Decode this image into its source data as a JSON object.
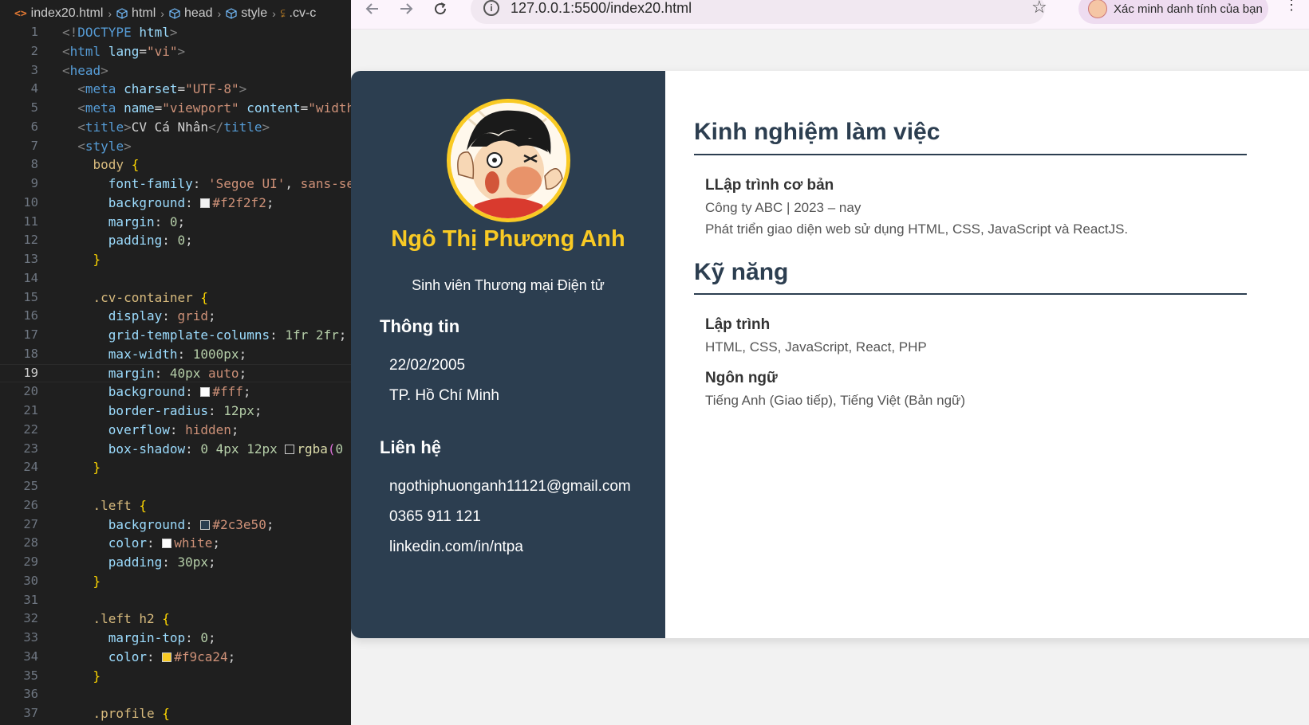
{
  "editor": {
    "breadcrumb": [
      "index20.html",
      "html",
      "head",
      "style",
      ".cv-c"
    ],
    "current_line": 19,
    "lines": [
      [
        [
          "t-punct",
          "<!"
        ],
        [
          "t-tag",
          "DOCTYPE"
        ],
        [
          "t-text",
          " "
        ],
        [
          "t-attr",
          "html"
        ],
        [
          "t-punct",
          ">"
        ]
      ],
      [
        [
          "t-punct",
          "<"
        ],
        [
          "t-tag",
          "html"
        ],
        [
          "t-text",
          " "
        ],
        [
          "t-attr",
          "lang"
        ],
        [
          "t-text",
          "="
        ],
        [
          "t-str",
          "\"vi\""
        ],
        [
          "t-punct",
          ">"
        ]
      ],
      [
        [
          "t-punct",
          "<"
        ],
        [
          "t-tag",
          "head"
        ],
        [
          "t-punct",
          ">"
        ]
      ],
      [
        [
          "t-text",
          "  "
        ],
        [
          "t-punct",
          "<"
        ],
        [
          "t-tag",
          "meta"
        ],
        [
          "t-text",
          " "
        ],
        [
          "t-attr",
          "charset"
        ],
        [
          "t-text",
          "="
        ],
        [
          "t-str",
          "\"UTF-8\""
        ],
        [
          "t-punct",
          ">"
        ]
      ],
      [
        [
          "t-text",
          "  "
        ],
        [
          "t-punct",
          "<"
        ],
        [
          "t-tag",
          "meta"
        ],
        [
          "t-text",
          " "
        ],
        [
          "t-attr",
          "name"
        ],
        [
          "t-text",
          "="
        ],
        [
          "t-str",
          "\"viewport\""
        ],
        [
          "t-text",
          " "
        ],
        [
          "t-attr",
          "content"
        ],
        [
          "t-text",
          "="
        ],
        [
          "t-str",
          "\"width"
        ]
      ],
      [
        [
          "t-text",
          "  "
        ],
        [
          "t-punct",
          "<"
        ],
        [
          "t-tag",
          "title"
        ],
        [
          "t-punct",
          ">"
        ],
        [
          "t-text",
          "CV Cá Nhân"
        ],
        [
          "t-punct",
          "</"
        ],
        [
          "t-tag",
          "title"
        ],
        [
          "t-punct",
          ">"
        ]
      ],
      [
        [
          "t-text",
          "  "
        ],
        [
          "t-punct",
          "<"
        ],
        [
          "t-tag",
          "style"
        ],
        [
          "t-punct",
          ">"
        ]
      ],
      [
        [
          "t-text",
          "    "
        ],
        [
          "t-sel",
          "body"
        ],
        [
          "t-text",
          " "
        ],
        [
          "t-brace",
          "{"
        ]
      ],
      [
        [
          "t-text",
          "      "
        ],
        [
          "t-prop",
          "font-family"
        ],
        [
          "t-text",
          ": "
        ],
        [
          "t-val",
          "'Segoe UI'"
        ],
        [
          "t-text",
          ", "
        ],
        [
          "t-val",
          "sans-se"
        ]
      ],
      [
        [
          "t-text",
          "      "
        ],
        [
          "t-prop",
          "background"
        ],
        [
          "t-text",
          ": "
        ],
        [
          "swatch",
          "#f2f2f2"
        ],
        [
          "t-val",
          "#f2f2f2"
        ],
        [
          "t-text",
          ";"
        ]
      ],
      [
        [
          "t-text",
          "      "
        ],
        [
          "t-prop",
          "margin"
        ],
        [
          "t-text",
          ": "
        ],
        [
          "t-num",
          "0"
        ],
        [
          "t-text",
          ";"
        ]
      ],
      [
        [
          "t-text",
          "      "
        ],
        [
          "t-prop",
          "padding"
        ],
        [
          "t-text",
          ": "
        ],
        [
          "t-num",
          "0"
        ],
        [
          "t-text",
          ";"
        ]
      ],
      [
        [
          "t-text",
          "    "
        ],
        [
          "t-brace",
          "}"
        ]
      ],
      [
        [
          "t-text",
          ""
        ]
      ],
      [
        [
          "t-text",
          "    "
        ],
        [
          "t-sel",
          ".cv-container"
        ],
        [
          "t-text",
          " "
        ],
        [
          "t-brace",
          "{"
        ]
      ],
      [
        [
          "t-text",
          "      "
        ],
        [
          "t-prop",
          "display"
        ],
        [
          "t-text",
          ": "
        ],
        [
          "t-val",
          "grid"
        ],
        [
          "t-text",
          ";"
        ]
      ],
      [
        [
          "t-text",
          "      "
        ],
        [
          "t-prop",
          "grid-template-columns"
        ],
        [
          "t-text",
          ": "
        ],
        [
          "t-num",
          "1fr 2fr"
        ],
        [
          "t-text",
          ";"
        ]
      ],
      [
        [
          "t-text",
          "      "
        ],
        [
          "t-prop",
          "max-width"
        ],
        [
          "t-text",
          ": "
        ],
        [
          "t-num",
          "1000px"
        ],
        [
          "t-text",
          ";"
        ]
      ],
      [
        [
          "t-text",
          "      "
        ],
        [
          "t-prop",
          "margin"
        ],
        [
          "t-text",
          ": "
        ],
        [
          "t-num",
          "40px"
        ],
        [
          "t-text",
          " "
        ],
        [
          "t-val",
          "auto"
        ],
        [
          "t-text",
          ";"
        ]
      ],
      [
        [
          "t-text",
          "      "
        ],
        [
          "t-prop",
          "background"
        ],
        [
          "t-text",
          ": "
        ],
        [
          "swatch",
          "#ffffff"
        ],
        [
          "t-val",
          "#fff"
        ],
        [
          "t-text",
          ";"
        ]
      ],
      [
        [
          "t-text",
          "      "
        ],
        [
          "t-prop",
          "border-radius"
        ],
        [
          "t-text",
          ": "
        ],
        [
          "t-num",
          "12px"
        ],
        [
          "t-text",
          ";"
        ]
      ],
      [
        [
          "t-text",
          "      "
        ],
        [
          "t-prop",
          "overflow"
        ],
        [
          "t-text",
          ": "
        ],
        [
          "t-val",
          "hidden"
        ],
        [
          "t-text",
          ";"
        ]
      ],
      [
        [
          "t-text",
          "      "
        ],
        [
          "t-prop",
          "box-shadow"
        ],
        [
          "t-text",
          ": "
        ],
        [
          "t-num",
          "0 4px 12px"
        ],
        [
          "t-text",
          " "
        ],
        [
          "swatch",
          "#1f1f1f"
        ],
        [
          "t-fn",
          "rgba"
        ],
        [
          "t-brace2",
          "("
        ],
        [
          "t-num",
          "0"
        ]
      ],
      [
        [
          "t-text",
          "    "
        ],
        [
          "t-brace",
          "}"
        ]
      ],
      [
        [
          "t-text",
          ""
        ]
      ],
      [
        [
          "t-text",
          "    "
        ],
        [
          "t-sel",
          ".left"
        ],
        [
          "t-text",
          " "
        ],
        [
          "t-brace",
          "{"
        ]
      ],
      [
        [
          "t-text",
          "      "
        ],
        [
          "t-prop",
          "background"
        ],
        [
          "t-text",
          ": "
        ],
        [
          "swatch",
          "#2c3e50"
        ],
        [
          "t-val",
          "#2c3e50"
        ],
        [
          "t-text",
          ";"
        ]
      ],
      [
        [
          "t-text",
          "      "
        ],
        [
          "t-prop",
          "color"
        ],
        [
          "t-text",
          ": "
        ],
        [
          "swatch",
          "#ffffff"
        ],
        [
          "t-val",
          "white"
        ],
        [
          "t-text",
          ";"
        ]
      ],
      [
        [
          "t-text",
          "      "
        ],
        [
          "t-prop",
          "padding"
        ],
        [
          "t-text",
          ": "
        ],
        [
          "t-num",
          "30px"
        ],
        [
          "t-text",
          ";"
        ]
      ],
      [
        [
          "t-text",
          "    "
        ],
        [
          "t-brace",
          "}"
        ]
      ],
      [
        [
          "t-text",
          ""
        ]
      ],
      [
        [
          "t-text",
          "    "
        ],
        [
          "t-sel",
          ".left h2"
        ],
        [
          "t-text",
          " "
        ],
        [
          "t-brace",
          "{"
        ]
      ],
      [
        [
          "t-text",
          "      "
        ],
        [
          "t-prop",
          "margin-top"
        ],
        [
          "t-text",
          ": "
        ],
        [
          "t-num",
          "0"
        ],
        [
          "t-text",
          ";"
        ]
      ],
      [
        [
          "t-text",
          "      "
        ],
        [
          "t-prop",
          "color"
        ],
        [
          "t-text",
          ": "
        ],
        [
          "swatch",
          "#f9ca24"
        ],
        [
          "t-val",
          "#f9ca24"
        ],
        [
          "t-text",
          ";"
        ]
      ],
      [
        [
          "t-text",
          "    "
        ],
        [
          "t-brace",
          "}"
        ]
      ],
      [
        [
          "t-text",
          ""
        ]
      ],
      [
        [
          "t-text",
          "    "
        ],
        [
          "t-sel",
          ".profile"
        ],
        [
          "t-text",
          " "
        ],
        [
          "t-brace",
          "{"
        ]
      ]
    ]
  },
  "browser": {
    "url": "127.0.0.1:5500/index20.html",
    "identity_label": "Xác minh danh tính của bạn",
    "icons": {
      "back": "back-arrow-icon",
      "forward": "forward-arrow-icon",
      "reload": "reload-icon",
      "info": "info-icon",
      "star": "star-icon",
      "menu": "kebab-menu-icon"
    }
  },
  "cv": {
    "name": "Ngô Thị Phương Anh",
    "role": "Sinh viên Thương mại Điện tử",
    "info_heading": "Thông tin",
    "birthday": "22/02/2005",
    "city": "TP. Hồ Chí Minh",
    "contact_heading": "Liên hệ",
    "email": "ngothiphuonganh11121@gmail.com",
    "phone": "0365 911 121",
    "linkedin": "linkedin.com/in/ntpa",
    "experience_heading": "Kinh nghiệm làm việc",
    "job_title": "LLập trình cơ bản",
    "job_company": "Công ty ABC | 2023 – nay",
    "job_desc": "Phát triển giao diện web sử dụng HTML, CSS, JavaScript và ReactJS.",
    "skills_heading": "Kỹ năng",
    "skill1_title": "Lập trình",
    "skill1_text": "HTML, CSS, JavaScript, React, PHP",
    "skill2_title": "Ngôn ngữ",
    "skill2_text": "Tiếng Anh (Giao tiếp), Tiếng Việt (Bản ngữ)",
    "colors": {
      "sidebar": "#2c3e50",
      "accent": "#f9ca24"
    }
  }
}
